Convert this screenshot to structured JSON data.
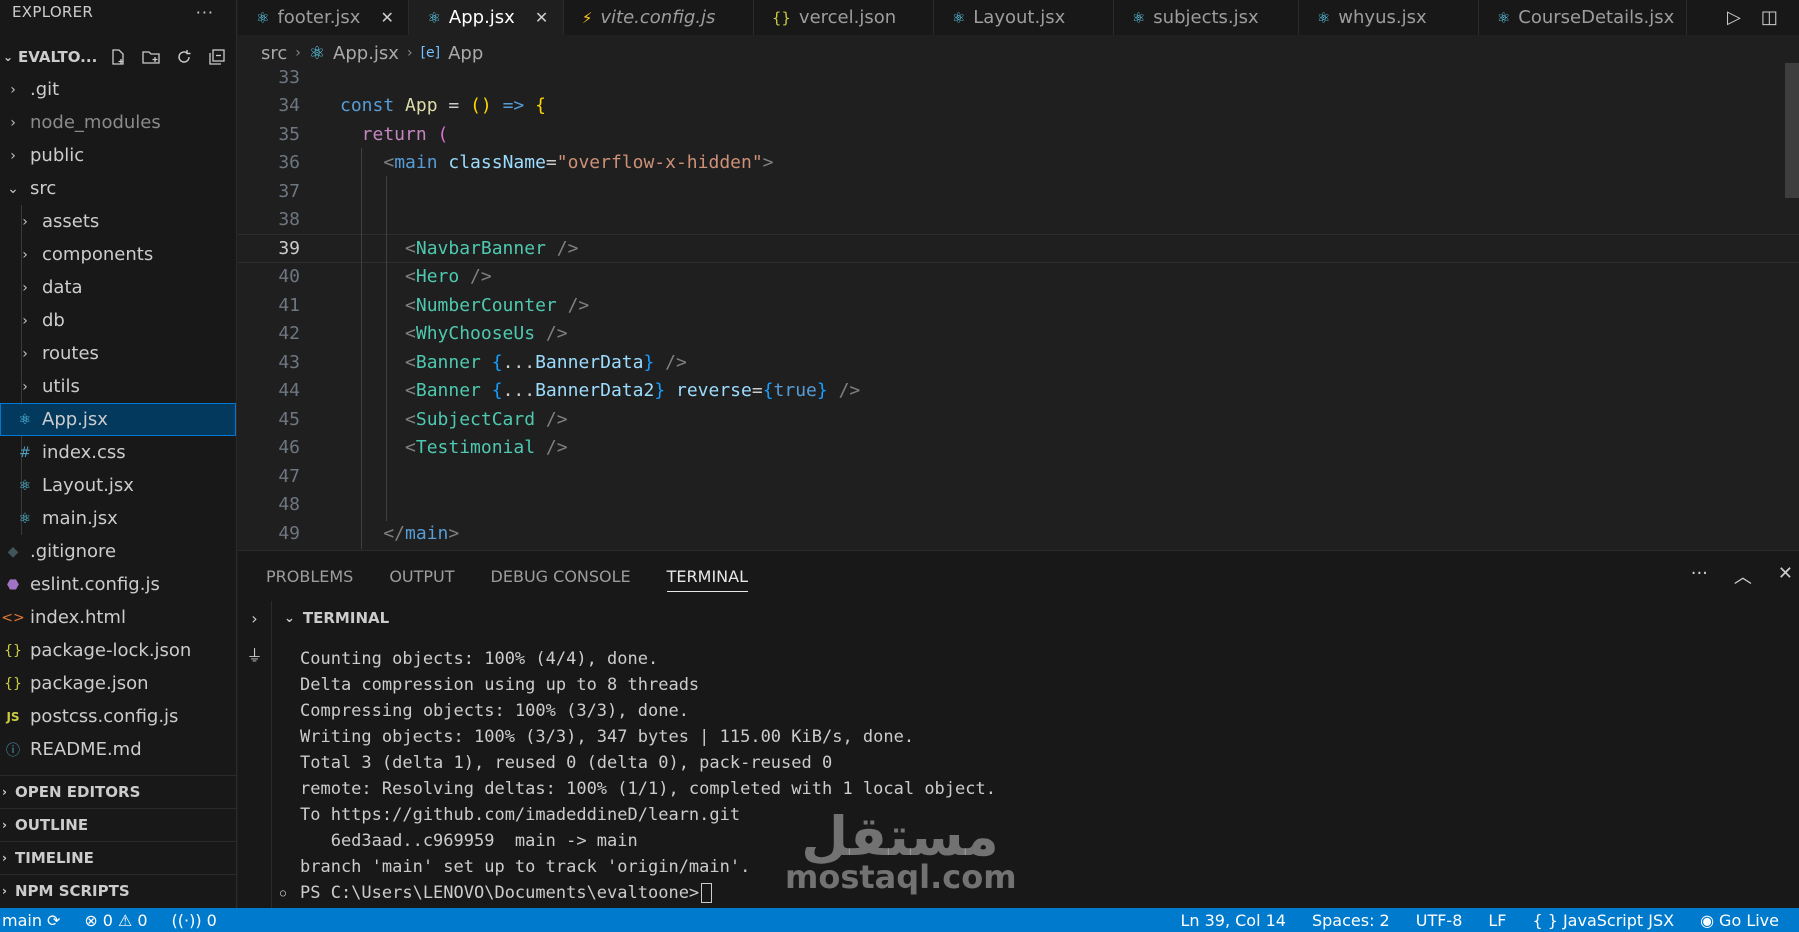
{
  "explorer": {
    "title": "EXPLORER",
    "more": "···",
    "root": "EVALTO...",
    "items": [
      {
        "label": ".git",
        "type": "folder",
        "dim": false
      },
      {
        "label": "node_modules",
        "type": "folder",
        "dim": true
      },
      {
        "label": "public",
        "type": "folder",
        "dim": false
      },
      {
        "label": "src",
        "type": "folder-open",
        "dim": false
      },
      {
        "label": "assets",
        "type": "folder",
        "dim": false
      },
      {
        "label": "components",
        "type": "folder",
        "dim": false
      },
      {
        "label": "data",
        "type": "folder",
        "dim": false
      },
      {
        "label": "db",
        "type": "folder",
        "dim": false
      },
      {
        "label": "routes",
        "type": "folder",
        "dim": false
      },
      {
        "label": "utils",
        "type": "folder",
        "dim": false
      },
      {
        "label": "App.jsx",
        "type": "react",
        "selected": true
      },
      {
        "label": "index.css",
        "type": "css"
      },
      {
        "label": "Layout.jsx",
        "type": "react"
      },
      {
        "label": "main.jsx",
        "type": "react"
      },
      {
        "label": ".gitignore",
        "type": "git"
      },
      {
        "label": "eslint.config.js",
        "type": "eslint"
      },
      {
        "label": "index.html",
        "type": "html"
      },
      {
        "label": "package-lock.json",
        "type": "json"
      },
      {
        "label": "package.json",
        "type": "json"
      },
      {
        "label": "postcss.config.js",
        "type": "js"
      },
      {
        "label": "README.md",
        "type": "info"
      }
    ],
    "sections": [
      "OPEN EDITORS",
      "OUTLINE",
      "TIMELINE",
      "NPM SCRIPTS"
    ]
  },
  "tabs": [
    {
      "label": "footer.jsx",
      "icon": "react",
      "active": false,
      "close": true
    },
    {
      "label": "App.jsx",
      "icon": "react",
      "active": true,
      "close": true
    },
    {
      "label": "vite.config.js",
      "icon": "vite",
      "active": false,
      "italic": true
    },
    {
      "label": "vercel.json",
      "icon": "json",
      "active": false
    },
    {
      "label": "Layout.jsx",
      "icon": "react",
      "active": false
    },
    {
      "label": "subjects.jsx",
      "icon": "react",
      "active": false
    },
    {
      "label": "whyus.jsx",
      "icon": "react",
      "active": false
    },
    {
      "label": "CourseDetails.jsx",
      "icon": "react",
      "active": false
    }
  ],
  "breadcrumb": {
    "folder": "src",
    "file": "App.jsx",
    "symbol": "App"
  },
  "editor": {
    "current_line": 39,
    "lines": [
      {
        "n": "33",
        "tokens": []
      },
      {
        "n": "34",
        "tokens": [
          [
            "const ",
            "k-blue"
          ],
          [
            "App",
            "k-fn"
          ],
          [
            " = ",
            "k-plain"
          ],
          [
            "()",
            "k-gold"
          ],
          [
            " => ",
            "k-blue"
          ],
          [
            "{",
            "k-gold"
          ]
        ]
      },
      {
        "n": "35",
        "tokens": [
          [
            "  return ",
            "k-purple"
          ],
          [
            "(",
            "k-pink"
          ]
        ]
      },
      {
        "n": "36",
        "tokens": [
          [
            "    <",
            "k-br"
          ],
          [
            "main",
            "k-blue"
          ],
          [
            " className",
            "k-attr"
          ],
          [
            "=",
            "k-plain"
          ],
          [
            "\"overflow-x-hidden\"",
            "k-str"
          ],
          [
            ">",
            "k-br"
          ]
        ]
      },
      {
        "n": "37",
        "tokens": []
      },
      {
        "n": "38",
        "tokens": []
      },
      {
        "n": "39",
        "tokens": [
          [
            "      <",
            "k-br"
          ],
          [
            "NavbarBanner",
            "k-tag"
          ],
          [
            " />",
            "k-br"
          ]
        ]
      },
      {
        "n": "40",
        "tokens": [
          [
            "      <",
            "k-br"
          ],
          [
            "Hero",
            "k-tag"
          ],
          [
            " />",
            "k-br"
          ]
        ]
      },
      {
        "n": "41",
        "tokens": [
          [
            "      <",
            "k-br"
          ],
          [
            "NumberCounter",
            "k-tag"
          ],
          [
            " />",
            "k-br"
          ]
        ]
      },
      {
        "n": "42",
        "tokens": [
          [
            "      <",
            "k-br"
          ],
          [
            "WhyChooseUs",
            "k-tag"
          ],
          [
            " />",
            "k-br"
          ]
        ]
      },
      {
        "n": "43",
        "tokens": [
          [
            "      <",
            "k-br"
          ],
          [
            "Banner",
            "k-tag"
          ],
          [
            " ",
            "k-plain"
          ],
          [
            "{",
            "k-cyan"
          ],
          [
            "...",
            "k-plain"
          ],
          [
            "BannerData",
            "k-var"
          ],
          [
            "}",
            "k-cyan"
          ],
          [
            " />",
            "k-br"
          ]
        ]
      },
      {
        "n": "44",
        "tokens": [
          [
            "      <",
            "k-br"
          ],
          [
            "Banner",
            "k-tag"
          ],
          [
            " ",
            "k-plain"
          ],
          [
            "{",
            "k-cyan"
          ],
          [
            "...",
            "k-plain"
          ],
          [
            "BannerData2",
            "k-var"
          ],
          [
            "}",
            "k-cyan"
          ],
          [
            " reverse",
            "k-attr"
          ],
          [
            "=",
            "k-plain"
          ],
          [
            "{",
            "k-cyan"
          ],
          [
            "true",
            "k-blue"
          ],
          [
            "}",
            "k-cyan"
          ],
          [
            " />",
            "k-br"
          ]
        ]
      },
      {
        "n": "45",
        "tokens": [
          [
            "      <",
            "k-br"
          ],
          [
            "SubjectCard",
            "k-tag"
          ],
          [
            " />",
            "k-br"
          ]
        ]
      },
      {
        "n": "46",
        "tokens": [
          [
            "      <",
            "k-br"
          ],
          [
            "Testimonial",
            "k-tag"
          ],
          [
            " />",
            "k-br"
          ]
        ]
      },
      {
        "n": "47",
        "tokens": []
      },
      {
        "n": "48",
        "tokens": []
      },
      {
        "n": "49",
        "tokens": [
          [
            "    </",
            "k-br"
          ],
          [
            "main",
            "k-blue"
          ],
          [
            ">",
            "k-br"
          ]
        ]
      }
    ]
  },
  "panel": {
    "tabs": [
      "PROBLEMS",
      "OUTPUT",
      "DEBUG CONSOLE",
      "TERMINAL"
    ],
    "active_tab": "TERMINAL",
    "terminal_title": "TERMINAL",
    "lines": [
      "Counting objects: 100% (4/4), done.",
      "Delta compression using up to 8 threads",
      "Compressing objects: 100% (3/3), done.",
      "Writing objects: 100% (3/3), 347 bytes | 115.00 KiB/s, done.",
      "Total 3 (delta 1), reused 0 (delta 0), pack-reused 0",
      "remote: Resolving deltas: 100% (1/1), completed with 1 local object.",
      "To https://github.com/imadeddineD/learn.git",
      "   6ed3aad..c969959  main -> main",
      "branch 'main' set up to track 'origin/main'."
    ],
    "prompt": "PS C:\\Users\\LENOVO\\Documents\\evaltoone>"
  },
  "watermark": {
    "arabic": "مستقل",
    "latin": "mostaql.com"
  },
  "statusbar": {
    "branch": "main",
    "errors": "0",
    "warnings": "0",
    "ports": "0",
    "position": "Ln 39, Col 14",
    "spaces": "Spaces: 2",
    "encoding": "UTF-8",
    "eol": "LF",
    "language": "JavaScript JSX",
    "golive": "Go Live"
  },
  "colors": {
    "accent": "#007acc",
    "selection": "#04395e"
  }
}
